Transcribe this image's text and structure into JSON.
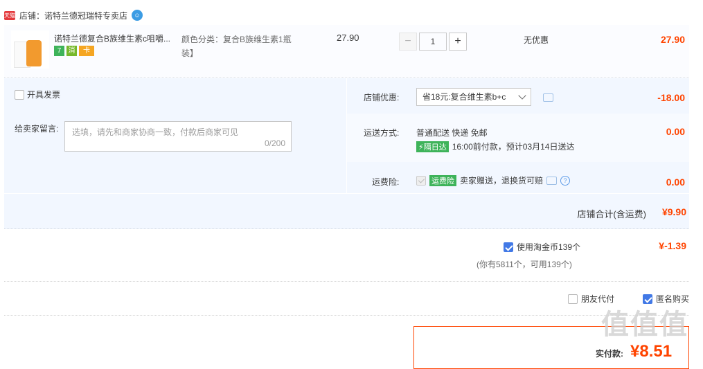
{
  "store": {
    "logo_text": "天猫",
    "label": "店铺：诺特兰德冠瑞特专卖店",
    "chat_icon": "wangwang-icon"
  },
  "item": {
    "title": "诺特兰德复合B族维生素c咀嚼...",
    "sku_label": "颜色分类：",
    "sku_value": "复合B族维生素1瓶装】",
    "unit_price": "27.90",
    "quantity": "1",
    "promo": "无优惠",
    "total": "27.90",
    "badges": [
      "7",
      "消",
      "卡"
    ]
  },
  "invoice": {
    "label": "开具发票"
  },
  "message": {
    "label": "给卖家留言:",
    "placeholder": "选填，请先和商家协商一致，付款后商家可见",
    "count": "0/200"
  },
  "store_coupon": {
    "label": "店铺优惠:",
    "selected": "省18元:复合维生素b+c",
    "amount": "-18.00"
  },
  "delivery": {
    "label": "运送方式:",
    "method": "普通配送 快递 免邮",
    "tag": "隔日达",
    "detail": "16:00前付款，预计03月14日送达",
    "amount": "0.00"
  },
  "insurance": {
    "label": "运费险:",
    "tag": "运费险",
    "detail": "卖家赠送，退换货可赔",
    "amount": "0.00"
  },
  "subtotal": {
    "label": "店铺合计(含运费)",
    "amount": "¥9.90"
  },
  "taojinbi": {
    "label": "使用淘金币139个",
    "sub": "(你有5811个，可用139个)",
    "amount": "¥-1.39"
  },
  "options": {
    "friend_pay": "朋友代付",
    "anonymous": "匿名购买"
  },
  "payment": {
    "label": "实付款:",
    "amount": "8.51"
  },
  "watermark": "值值值"
}
